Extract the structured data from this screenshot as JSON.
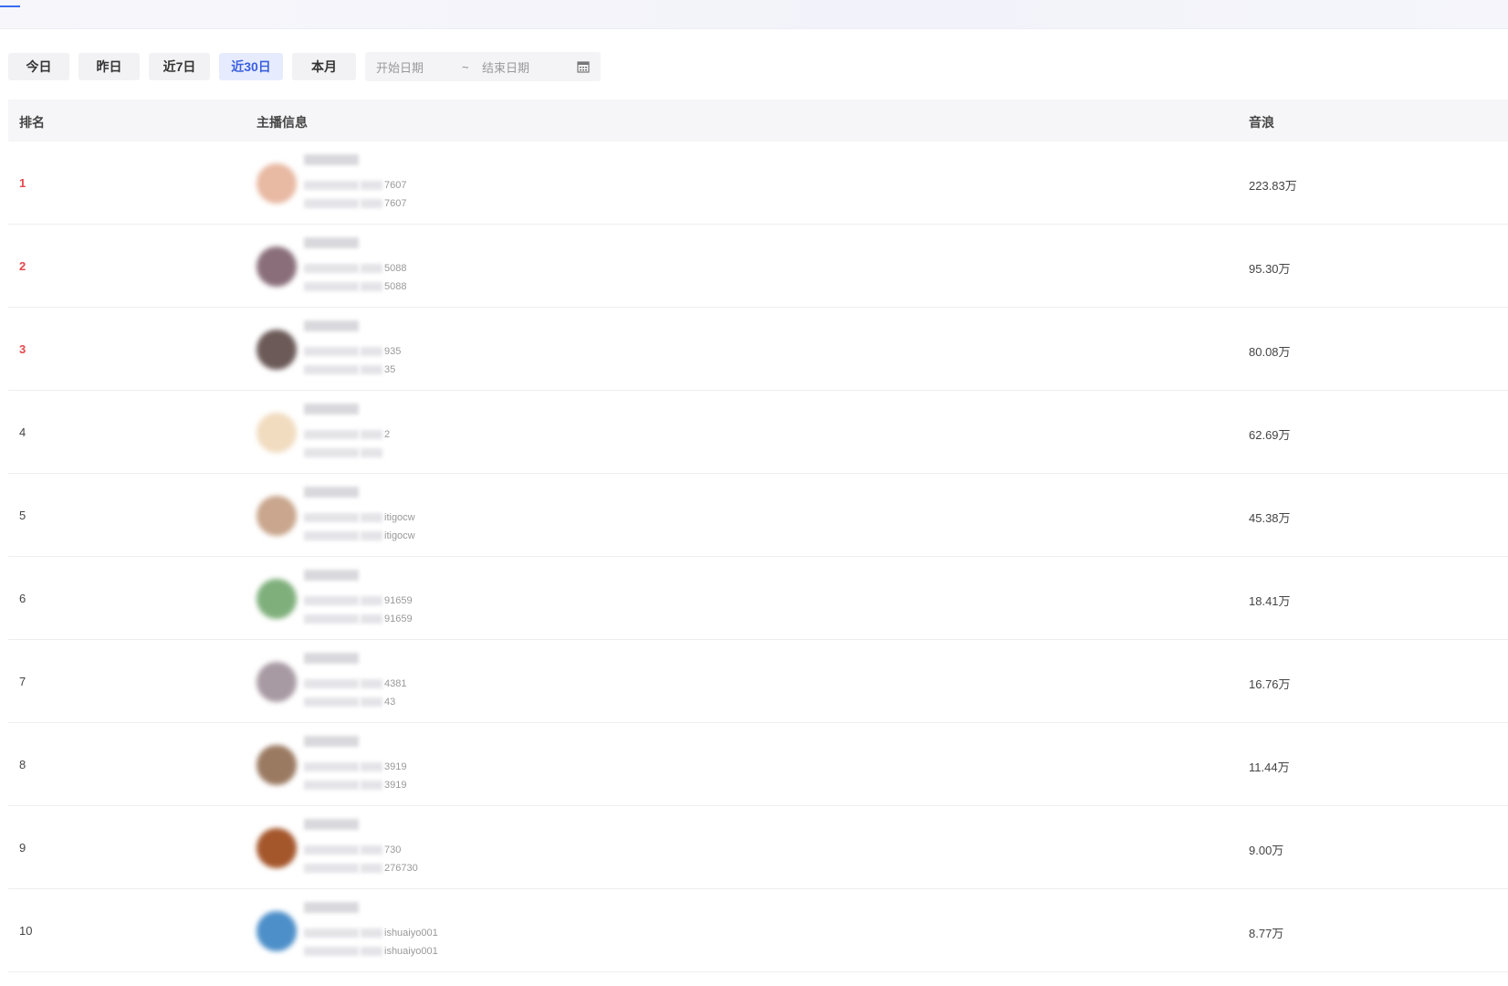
{
  "filters": {
    "buttons": [
      {
        "label": "今日",
        "active": false
      },
      {
        "label": "昨日",
        "active": false
      },
      {
        "label": "近7日",
        "active": false
      },
      {
        "label": "近30日",
        "active": true
      },
      {
        "label": "本月",
        "active": false
      }
    ],
    "start_placeholder": "开始日期",
    "separator": "~",
    "end_placeholder": "结束日期",
    "calendar_icon": "calendar-icon"
  },
  "table": {
    "headers": {
      "rank": "排名",
      "anchor": "主播信息",
      "value": "音浪"
    },
    "rows": [
      {
        "rank": "1",
        "suffix1": "7607",
        "suffix2": "7607",
        "value": "223.83万",
        "avatar_color": "#e8b9a3"
      },
      {
        "rank": "2",
        "suffix1": "5088",
        "suffix2": "5088",
        "value": "95.30万",
        "avatar_color": "#8a6f7a"
      },
      {
        "rank": "3",
        "suffix1": "935",
        "suffix2": "35",
        "value": "80.08万",
        "avatar_color": "#6b5a58"
      },
      {
        "rank": "4",
        "suffix1": "2",
        "suffix2": "",
        "value": "62.69万",
        "avatar_color": "#f1dcc0"
      },
      {
        "rank": "5",
        "suffix1": "itigocw",
        "suffix2": "itigocw",
        "value": "45.38万",
        "avatar_color": "#c9a68d"
      },
      {
        "rank": "6",
        "suffix1": "91659",
        "suffix2": "91659",
        "value": "18.41万",
        "avatar_color": "#7fb07c"
      },
      {
        "rank": "7",
        "suffix1": "4381",
        "suffix2": "43",
        "value": "16.76万",
        "avatar_color": "#a89aa3"
      },
      {
        "rank": "8",
        "suffix1": "3919",
        "suffix2": "3919",
        "value": "11.44万",
        "avatar_color": "#9b7a62"
      },
      {
        "rank": "9",
        "suffix1": "730",
        "suffix2": "276730",
        "value": "9.00万",
        "avatar_color": "#a5572c"
      },
      {
        "rank": "10",
        "suffix1": "ishuaiyo001",
        "suffix2": "ishuaiyo001",
        "value": "8.77万",
        "avatar_color": "#4d8fc9"
      }
    ]
  }
}
